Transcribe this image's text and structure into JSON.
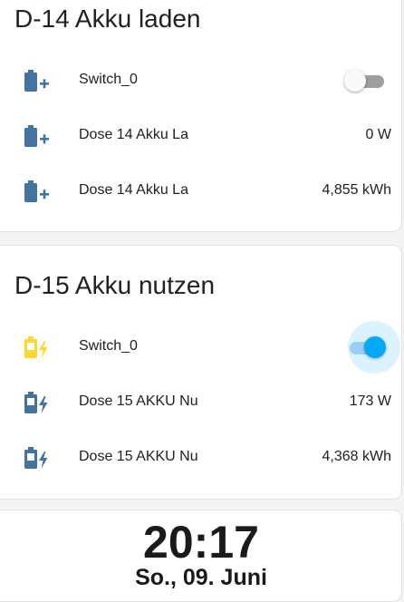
{
  "colors": {
    "icon_blue": "#44739e",
    "icon_active": "#fdd835",
    "toggle_on": "#03a9f4",
    "toggle_off": "#9e9e9e"
  },
  "cards": {
    "d14": {
      "title": "D-14 Akku laden",
      "rows": [
        {
          "icon": "battery-plus-icon",
          "label": "Switch_0",
          "state": "off"
        },
        {
          "icon": "battery-plus-icon",
          "label": "Dose 14 Akku La",
          "value": "0 W"
        },
        {
          "icon": "battery-plus-icon",
          "label": "Dose 14 Akku La",
          "value": "4,855 kWh"
        }
      ]
    },
    "d15": {
      "title": "D-15 Akku nutzen",
      "rows": [
        {
          "icon": "battery-charging-icon",
          "label": "Switch_0",
          "state": "on"
        },
        {
          "icon": "battery-charging-icon",
          "label": "Dose 15 AKKU Nu",
          "value": "173 W"
        },
        {
          "icon": "battery-charging-icon",
          "label": "Dose 15 AKKU Nu",
          "value": "4,368 kWh"
        }
      ]
    }
  },
  "clock": {
    "time": "20:17",
    "date": "So., 09. Juni"
  }
}
